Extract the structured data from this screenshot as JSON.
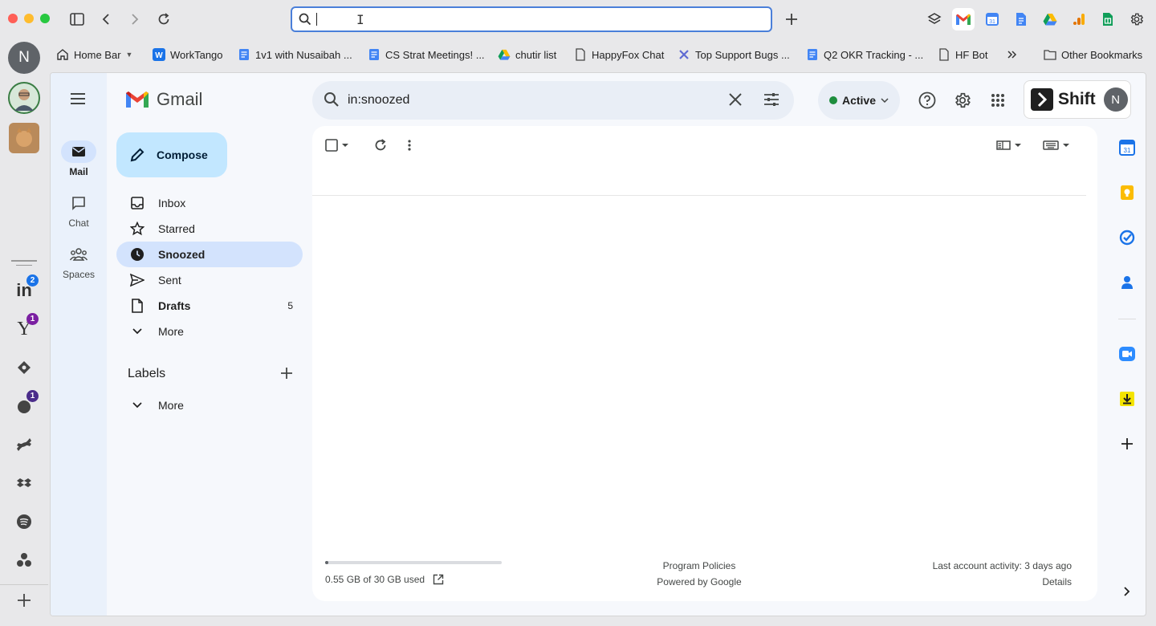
{
  "browser": {
    "url_value": "",
    "bookmarks": [
      {
        "label": "Home Bar",
        "icon": "home-icon"
      },
      {
        "label": "WorkTango",
        "icon": "worktango-icon"
      },
      {
        "label": "1v1 with Nusaibah ...",
        "icon": "doc-icon"
      },
      {
        "label": "CS Strat Meetings! ...",
        "icon": "doc-icon"
      },
      {
        "label": "chutir list",
        "icon": "drive-icon"
      },
      {
        "label": "HappyFox Chat",
        "icon": "page-icon"
      },
      {
        "label": "Top Support Bugs ...",
        "icon": "linear-icon"
      },
      {
        "label": "Q2 OKR Tracking - ...",
        "icon": "doc-icon"
      },
      {
        "label": "HF Bot",
        "icon": "page-icon"
      },
      {
        "label": "Other Bookmarks",
        "icon": "folder-icon"
      }
    ]
  },
  "apps": {
    "profile_initial": "N",
    "linkedin_badge": "2",
    "yahoo_badge": "1",
    "app_badge": "1"
  },
  "gmail": {
    "logo_text": "Gmail",
    "search_value": "in:snoozed",
    "status": "Active",
    "shift_label": "Shift",
    "avatar_initial": "N",
    "rail": [
      {
        "label": "Mail",
        "icon": "mail-icon"
      },
      {
        "label": "Chat",
        "icon": "chat-icon"
      },
      {
        "label": "Spaces",
        "icon": "spaces-icon"
      }
    ],
    "compose_label": "Compose",
    "nav": [
      {
        "label": "Inbox",
        "icon": "inbox-icon",
        "count": ""
      },
      {
        "label": "Starred",
        "icon": "star-icon",
        "count": ""
      },
      {
        "label": "Snoozed",
        "icon": "clock-icon",
        "count": ""
      },
      {
        "label": "Sent",
        "icon": "send-icon",
        "count": ""
      },
      {
        "label": "Drafts",
        "icon": "draft-icon",
        "count": "5"
      },
      {
        "label": "More",
        "icon": "chevron-down-icon",
        "count": ""
      }
    ],
    "labels_heading": "Labels",
    "labels_more": "More",
    "footer": {
      "storage_text": "0.55 GB of 30 GB used",
      "storage_fraction": 0.018,
      "program_policies": "Program Policies",
      "powered_by": "Powered by Google",
      "last_activity": "Last account activity: 3 days ago",
      "details": "Details"
    }
  }
}
